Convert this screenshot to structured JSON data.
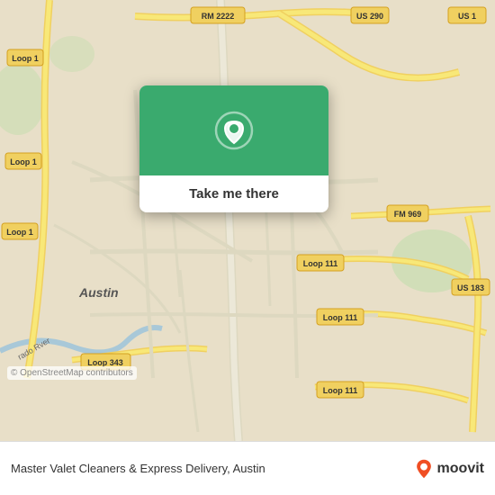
{
  "map": {
    "background_color": "#e8dfc8",
    "attribution": "© OpenStreetMap contributors"
  },
  "popup": {
    "button_label": "Take me there",
    "pin_icon": "location-pin"
  },
  "bottom_bar": {
    "place_name": "Master Valet Cleaners & Express Delivery, Austin",
    "brand": "moovit"
  },
  "road_labels": [
    "RM 2222",
    "US 290",
    "Loop 1",
    "FM 969",
    "Loop 111",
    "US 183",
    "Loop 343",
    "Austin"
  ]
}
